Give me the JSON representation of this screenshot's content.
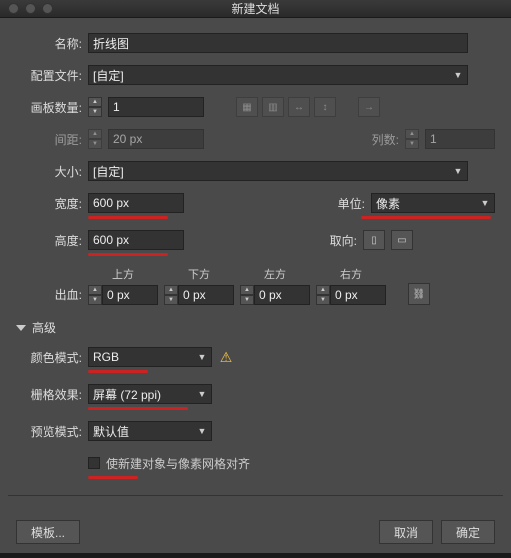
{
  "title": "新建文档",
  "name": {
    "label": "名称:",
    "value": "折线图"
  },
  "profile": {
    "label": "配置文件:",
    "value": "[自定]"
  },
  "artboards": {
    "label": "画板数量:",
    "value": "1"
  },
  "spacing": {
    "label": "间距:",
    "value": "20 px"
  },
  "columns": {
    "label": "列数:",
    "value": "1"
  },
  "size": {
    "label": "大小:",
    "value": "[自定]"
  },
  "width": {
    "label": "宽度:",
    "value": "600 px"
  },
  "units": {
    "label": "单位:",
    "value": "像素"
  },
  "height": {
    "label": "高度:",
    "value": "600 px"
  },
  "orient": {
    "label": "取向:"
  },
  "bleed": {
    "label": "出血:",
    "top": {
      "hdr": "上方",
      "value": "0 px"
    },
    "bottom": {
      "hdr": "下方",
      "value": "0 px"
    },
    "left": {
      "hdr": "左方",
      "value": "0 px"
    },
    "right": {
      "hdr": "右方",
      "value": "0 px"
    }
  },
  "advanced": "高级",
  "colormode": {
    "label": "颜色模式:",
    "value": "RGB"
  },
  "raster": {
    "label": "栅格效果:",
    "value": "屏幕 (72 ppi)"
  },
  "preview": {
    "label": "预览模式:",
    "value": "默认值"
  },
  "align": {
    "label": "使新建对象与像素网格对齐"
  },
  "buttons": {
    "template": "模板...",
    "cancel": "取消",
    "ok": "确定"
  }
}
